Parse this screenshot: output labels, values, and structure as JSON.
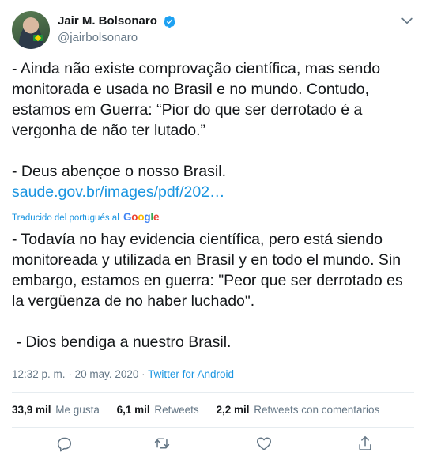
{
  "user": {
    "display_name": "Jair M. Bolsonaro",
    "handle": "@jairbolsonaro",
    "verified": true
  },
  "tweet": {
    "paragraph1": "- Ainda não existe comprovação científica, mas sendo monitorada e usada no Brasil e no mundo. Contudo, estamos em Guerra: “Pior do que ser derrotado é a vergonha de não ter lutado.”",
    "paragraph2": "- Deus abençoe o nosso Brasil.",
    "link_text": "saude.gov.br/images/pdf/202…"
  },
  "translation": {
    "label": "Traducido del portugués al",
    "provider_letters": [
      "G",
      "o",
      "o",
      "g",
      "l",
      "e"
    ],
    "paragraph1": "- Todavía no hay evidencia científica, pero está siendo monitoreada y utilizada en Brasil y en todo el mundo. Sin embargo, estamos en guerra: \"Peor que ser derrotado es la vergüenza de no haber luchado\".",
    "paragraph2": " - Dios bendiga a nuestro Brasil."
  },
  "meta": {
    "time": "12:32 p. m.",
    "separator": "·",
    "date": "20 may. 2020",
    "source": "Twitter for Android"
  },
  "stats": {
    "likes_count": "33,9 mil",
    "likes_label": "Me gusta",
    "retweets_count": "6,1 mil",
    "retweets_label": "Retweets",
    "quotes_count": "2,2 mil",
    "quotes_label": "Retweets con comentarios"
  },
  "colors": {
    "link": "#1b95e0",
    "secondary_text": "#657786",
    "verified": "#1da1f2",
    "divider": "#e6ecf0"
  },
  "icons": {
    "more": "chevron-down-icon",
    "reply": "reply-icon",
    "retweet": "retweet-icon",
    "like": "heart-icon",
    "share": "share-icon"
  }
}
